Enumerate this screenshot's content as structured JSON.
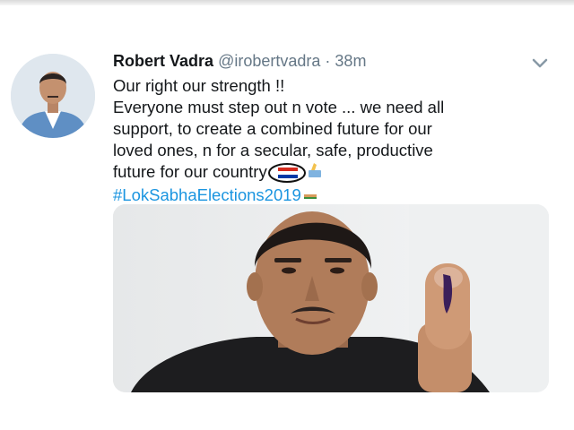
{
  "tweet": {
    "display_name": "Robert Vadra",
    "handle": "@irobertvadra",
    "separator": "·",
    "time": "38m",
    "lines": [
      "Our right our strength !!",
      "Everyone must step out n vote ... we need all",
      "support, to create a combined future for our",
      "loved ones, n for a secular, safe, productive",
      "future for our country"
    ],
    "hashtag": "#LokSabhaElections2019",
    "icons": {
      "menu": "chevron-down-icon",
      "flag": "flag-emoji-icon",
      "vote": "ballot-emoji-icon",
      "hashtag_emoji": "election-emoji-icon"
    }
  },
  "colors": {
    "link": "#1b95e0",
    "secondary_text": "#657786",
    "primary_text": "#14171a"
  }
}
